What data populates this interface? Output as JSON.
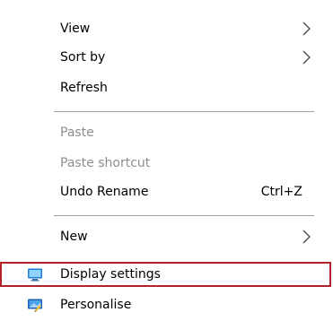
{
  "menu": {
    "items": [
      {
        "label": "View",
        "submenu": true
      },
      {
        "label": "Sort by",
        "submenu": true
      },
      {
        "label": "Refresh"
      },
      {
        "label": "Paste",
        "disabled": true
      },
      {
        "label": "Paste shortcut",
        "disabled": true
      },
      {
        "label": "Undo Rename",
        "shortcut": "Ctrl+Z"
      },
      {
        "label": "New",
        "submenu": true
      },
      {
        "label": "Display settings",
        "icon": "display-icon",
        "highlighted": true
      },
      {
        "label": "Personalise",
        "icon": "personalise-icon"
      }
    ]
  },
  "colors": {
    "highlight_border": "#b1222a",
    "disabled_text": "#8d8d8d",
    "separator": "#a0a0a0"
  }
}
